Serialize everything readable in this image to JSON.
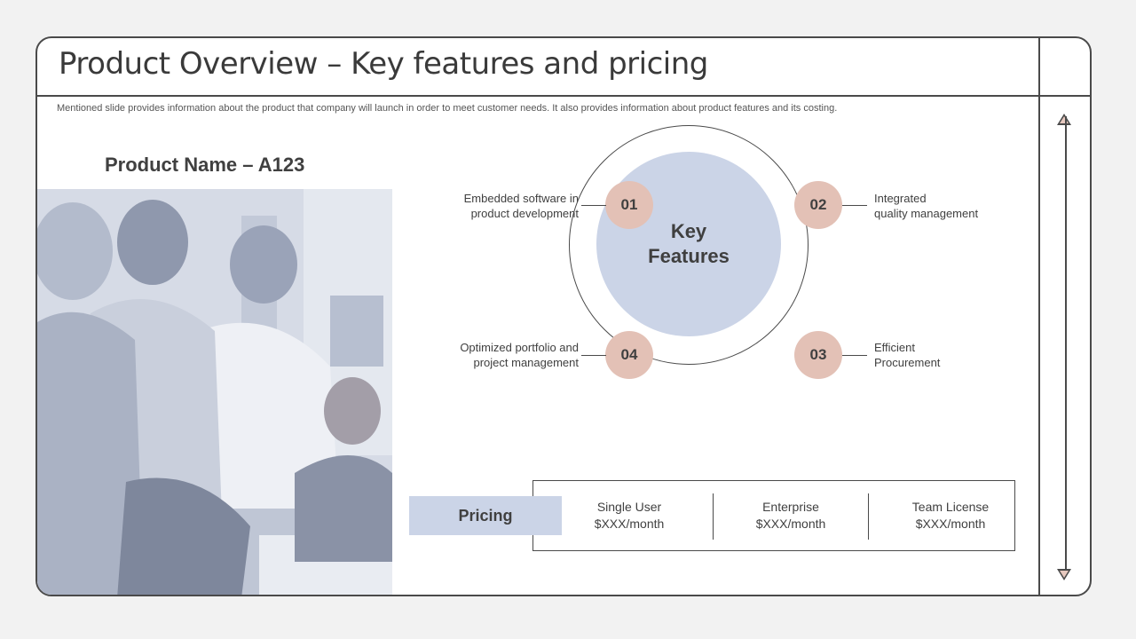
{
  "slide": {
    "title": "Product Overview – Key features and pricing",
    "subtitle": "Mentioned slide provides information about the product that company will launch in order to meet customer needs. It also provides information about product features and its costing."
  },
  "product": {
    "name": "Product Name – A123"
  },
  "features": {
    "center_label": "Key\nFeatures",
    "items": [
      {
        "number": "01",
        "label": "Embedded software in\nproduct development"
      },
      {
        "number": "02",
        "label": "Integrated\nquality management"
      },
      {
        "number": "03",
        "label": "Efficient\nProcurement"
      },
      {
        "number": "04",
        "label": "Optimized portfolio and\nproject management"
      }
    ]
  },
  "pricing": {
    "label": "Pricing",
    "plans": [
      {
        "name": "Single User",
        "price": "$XXX/month"
      },
      {
        "name": "Enterprise",
        "price": "$XXX/month"
      },
      {
        "name": "Team License",
        "price": "$XXX/month"
      }
    ]
  },
  "colors": {
    "accent_blue": "#cbd4e7",
    "accent_rose": "#e3c1b6",
    "frame": "#4a4a4a"
  }
}
